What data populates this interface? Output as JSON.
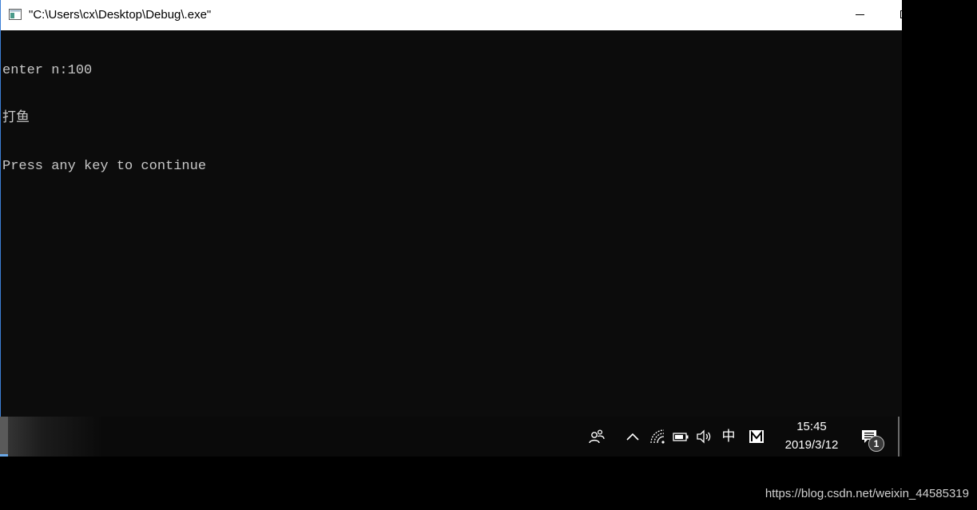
{
  "window": {
    "title": "\"C:\\Users\\cx\\Desktop\\Debug\\.exe\"",
    "icon": "console-app-icon"
  },
  "console": {
    "lines": [
      "enter n:100",
      "打鱼",
      "Press any key to continue"
    ]
  },
  "taskbar": {
    "tray_icons": [
      "people-icon",
      "chevron-up-icon",
      "wifi-icon",
      "battery-icon",
      "volume-icon"
    ],
    "ime_label": "中",
    "ime_mode_icon": "m-badge-icon",
    "clock": {
      "time": "15:45",
      "date": "2019/3/12"
    },
    "notification_count": "1"
  },
  "watermark": "https://blog.csdn.net/weixin_44585319",
  "colors": {
    "console_background": "#0c0c0c",
    "console_text": "#c8c8c8",
    "taskbar_background": "#0a0a0a",
    "window_border_accent": "#3c7fd6"
  }
}
